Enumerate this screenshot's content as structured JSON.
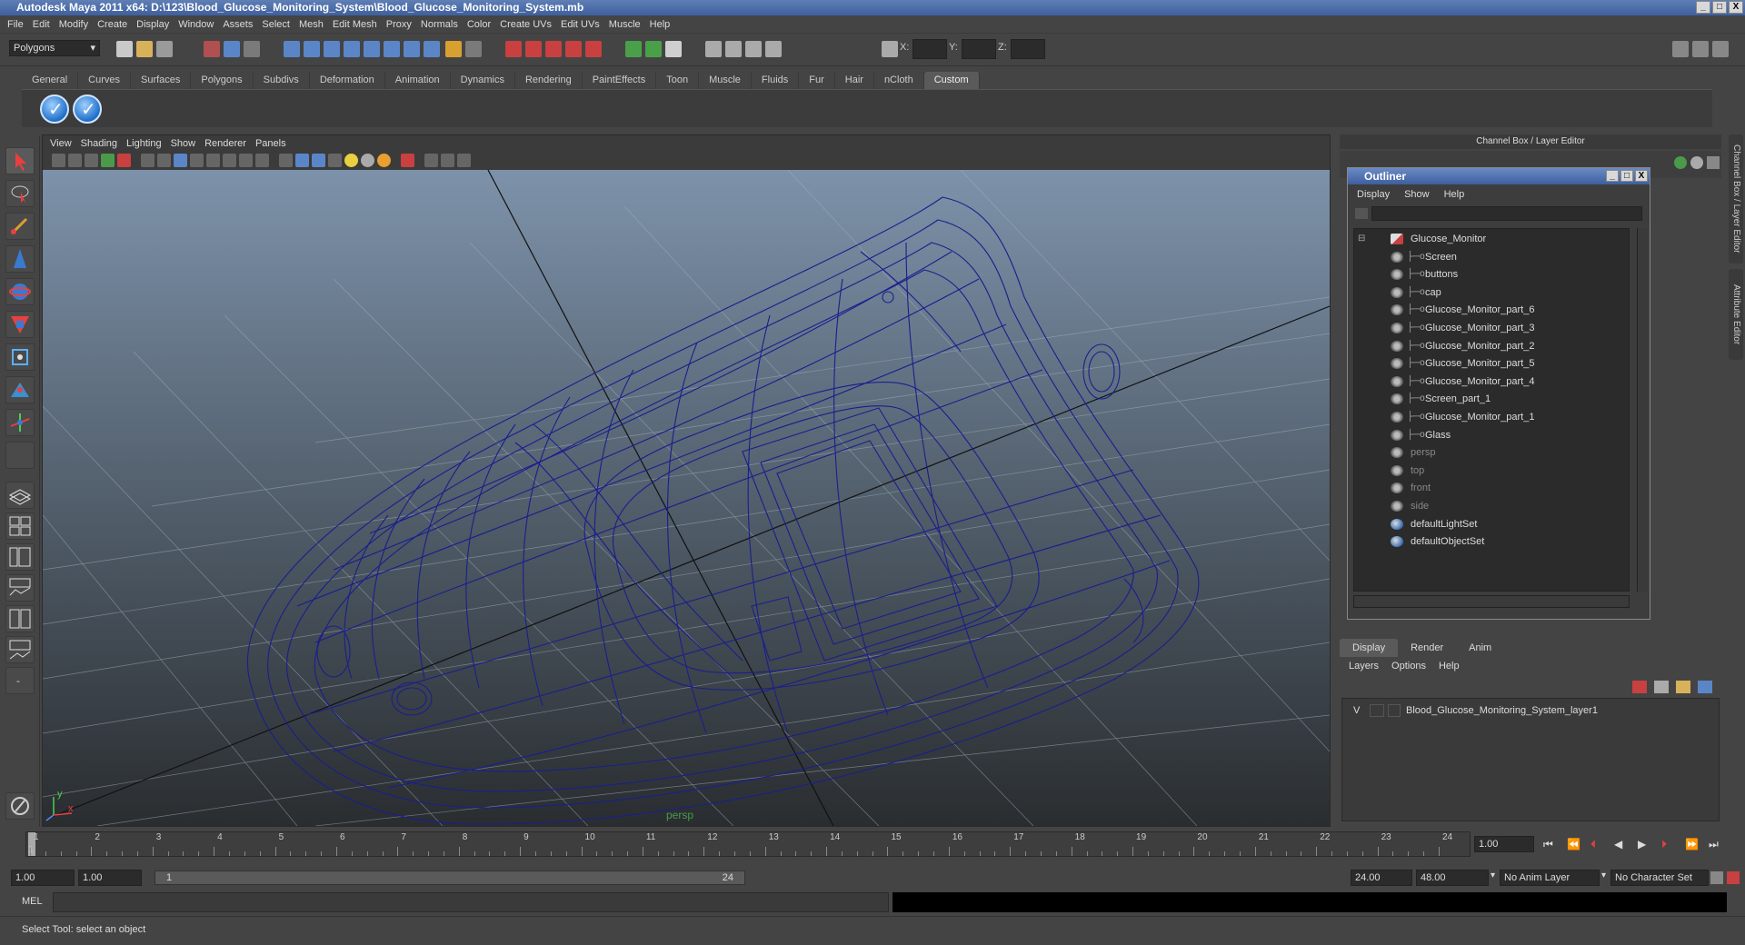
{
  "window": {
    "title": "Autodesk Maya 2011 x64: D:\\123\\Blood_Glucose_Monitoring_System\\Blood_Glucose_Monitoring_System.mb",
    "btn_min": "_",
    "btn_max": "□",
    "btn_close": "X"
  },
  "menubar": [
    "File",
    "Edit",
    "Modify",
    "Create",
    "Display",
    "Window",
    "Assets",
    "Select",
    "Mesh",
    "Edit Mesh",
    "Proxy",
    "Normals",
    "Color",
    "Create UVs",
    "Edit UVs",
    "Muscle",
    "Help"
  ],
  "statusline": {
    "mode": "Polygons",
    "x_label": "X:",
    "y_label": "Y:",
    "z_label": "Z:"
  },
  "shelf_tabs": [
    "General",
    "Curves",
    "Surfaces",
    "Polygons",
    "Subdivs",
    "Deformation",
    "Animation",
    "Dynamics",
    "Rendering",
    "PaintEffects",
    "Toon",
    "Muscle",
    "Fluids",
    "Fur",
    "Hair",
    "nCloth",
    "Custom"
  ],
  "shelf_active": "Custom",
  "viewport": {
    "menu": [
      "View",
      "Shading",
      "Lighting",
      "Show",
      "Renderer",
      "Panels"
    ],
    "camera_label": "persp",
    "axis_y": "y",
    "axis_x": "x"
  },
  "channel_box_title": "Channel Box / Layer Editor",
  "outliner": {
    "title": "Outliner",
    "menu": [
      "Display",
      "Show",
      "Help"
    ],
    "items": [
      {
        "label": "Glucose_Monitor",
        "level": 0,
        "dim": false,
        "icon": "group-icon"
      },
      {
        "label": "Screen",
        "level": 1,
        "dim": false,
        "icon": "mesh-icon"
      },
      {
        "label": "buttons",
        "level": 1,
        "dim": false,
        "icon": "mesh-icon"
      },
      {
        "label": "cap",
        "level": 1,
        "dim": false,
        "icon": "mesh-icon"
      },
      {
        "label": "Glucose_Monitor_part_6",
        "level": 1,
        "dim": false,
        "icon": "mesh-icon"
      },
      {
        "label": "Glucose_Monitor_part_3",
        "level": 1,
        "dim": false,
        "icon": "mesh-icon"
      },
      {
        "label": "Glucose_Monitor_part_2",
        "level": 1,
        "dim": false,
        "icon": "mesh-icon"
      },
      {
        "label": "Glucose_Monitor_part_5",
        "level": 1,
        "dim": false,
        "icon": "mesh-icon"
      },
      {
        "label": "Glucose_Monitor_part_4",
        "level": 1,
        "dim": false,
        "icon": "mesh-icon"
      },
      {
        "label": "Screen_part_1",
        "level": 1,
        "dim": false,
        "icon": "mesh-icon"
      },
      {
        "label": "Glucose_Monitor_part_1",
        "level": 1,
        "dim": false,
        "icon": "mesh-icon"
      },
      {
        "label": "Glass",
        "level": 1,
        "dim": false,
        "icon": "mesh-icon"
      },
      {
        "label": "persp",
        "level": 0,
        "dim": true,
        "icon": "camera-icon"
      },
      {
        "label": "top",
        "level": 0,
        "dim": true,
        "icon": "camera-icon"
      },
      {
        "label": "front",
        "level": 0,
        "dim": true,
        "icon": "camera-icon"
      },
      {
        "label": "side",
        "level": 0,
        "dim": true,
        "icon": "camera-icon"
      },
      {
        "label": "defaultLightSet",
        "level": 0,
        "dim": false,
        "icon": "set-icon"
      },
      {
        "label": "defaultObjectSet",
        "level": 0,
        "dim": false,
        "icon": "set-icon"
      }
    ]
  },
  "layer_editor": {
    "tabs": [
      "Display",
      "Render",
      "Anim"
    ],
    "active_tab": "Display",
    "menu": [
      "Layers",
      "Options",
      "Help"
    ],
    "layers": [
      {
        "visible": "V",
        "name": "Blood_Glucose_Monitoring_System_layer1"
      }
    ]
  },
  "side_tabs": [
    "Channel Box / Layer Editor",
    "Attribute Editor"
  ],
  "timeline": {
    "ticks": [
      "1",
      "2",
      "3",
      "4",
      "5",
      "6",
      "7",
      "8",
      "9",
      "10",
      "11",
      "12",
      "13",
      "14",
      "15",
      "16",
      "17",
      "18",
      "19",
      "20",
      "21",
      "22",
      "23",
      "24"
    ],
    "current_frame": "1",
    "current_time": "1.00"
  },
  "range": {
    "start": "1.00",
    "playback_start": "1.00",
    "slider_min": "1",
    "slider_max": "24",
    "playback_end": "24.00",
    "end": "48.00",
    "anim_layer": "No Anim Layer",
    "char_set": "No Character Set"
  },
  "cmdline": {
    "label": "MEL"
  },
  "helpline": {
    "text": "Select Tool: select an object"
  }
}
